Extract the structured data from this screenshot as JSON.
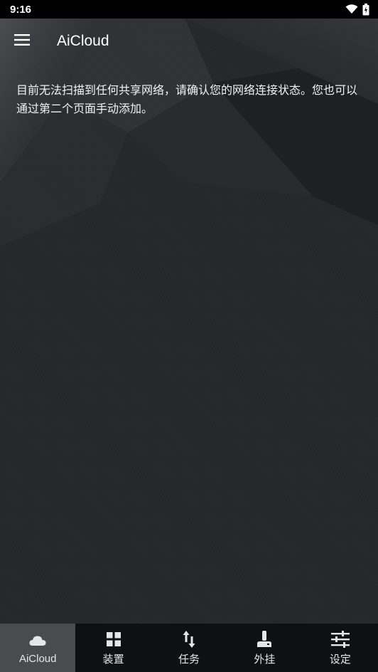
{
  "status_bar": {
    "time": "9:16",
    "icons": [
      "wifi-icon",
      "battery-icon"
    ]
  },
  "app_bar": {
    "menu_icon": "menu-icon",
    "title": "AiCloud"
  },
  "main": {
    "message": "目前无法扫描到任何共享网络，请确认您的网络连接状态。您也可以通过第二个页面手动添加。"
  },
  "bottom_nav": {
    "items": [
      {
        "label": "AiCloud",
        "icon": "cloud-icon",
        "active": true
      },
      {
        "label": "装置",
        "icon": "grid-icon",
        "active": false
      },
      {
        "label": "任务",
        "icon": "transfer-icon",
        "active": false
      },
      {
        "label": "外挂",
        "icon": "joystick-icon",
        "active": false
      },
      {
        "label": "设定",
        "icon": "sliders-icon",
        "active": false
      }
    ]
  },
  "colors": {
    "background": "#25282b",
    "status_bar": "#000000",
    "nav_bar": "#0f1012",
    "nav_active": "#4a4b4d",
    "text": "#f2f2f2"
  }
}
